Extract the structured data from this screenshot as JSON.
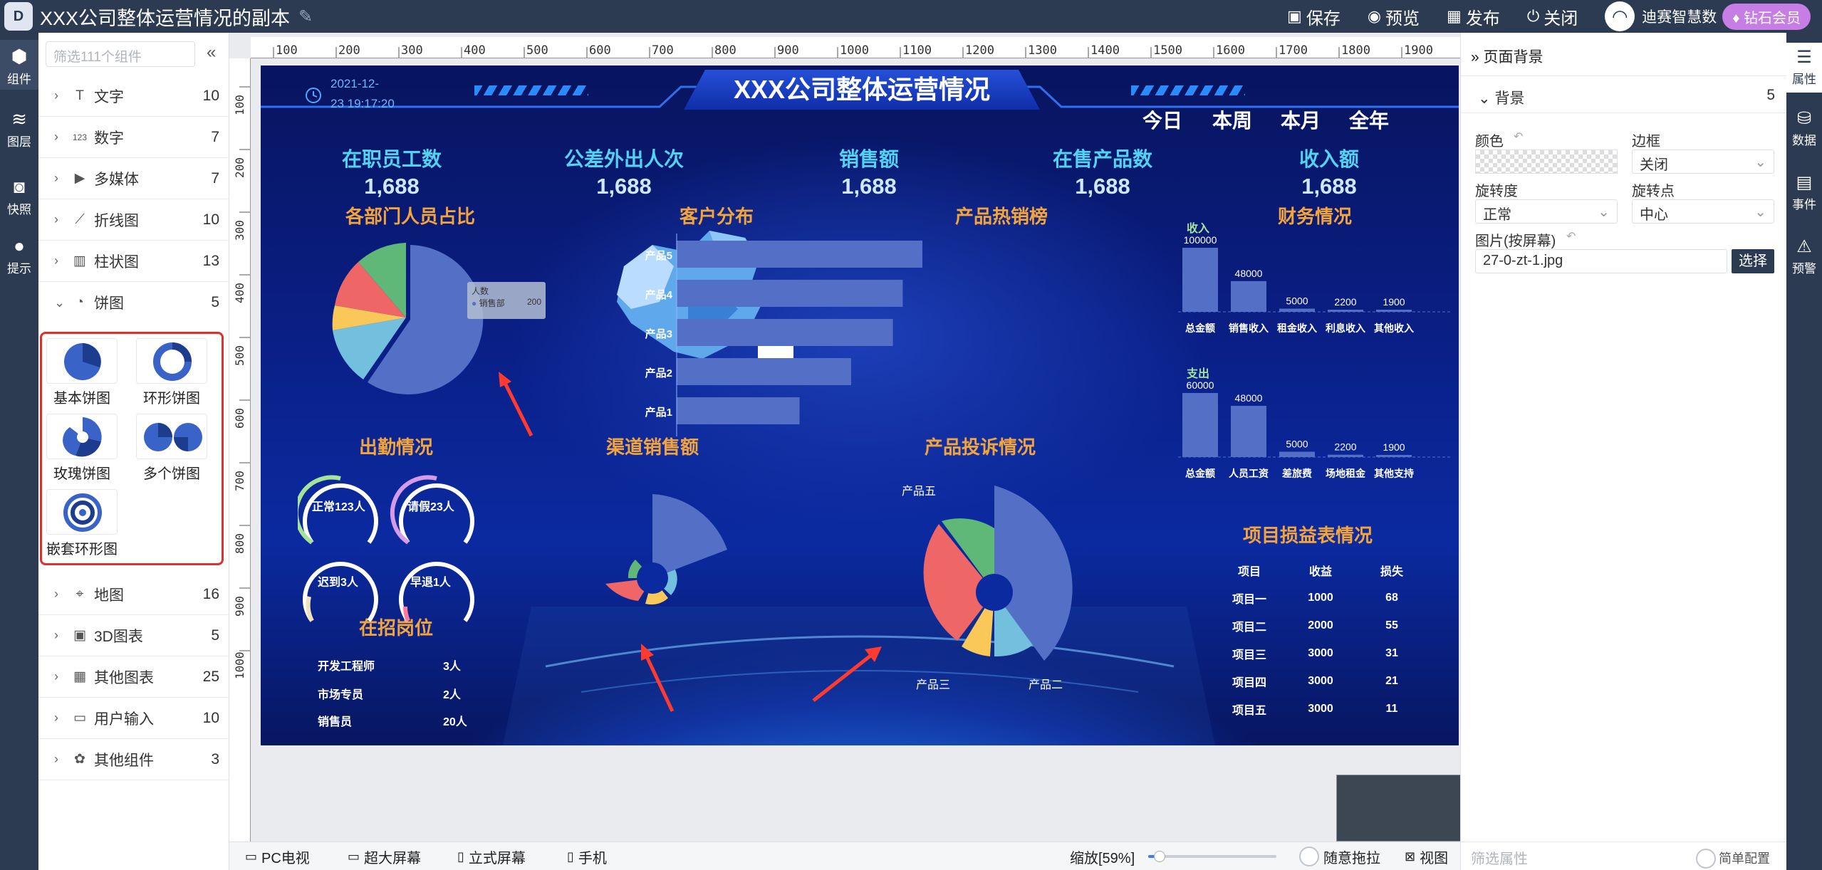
{
  "app": {
    "doc_title": "XXX公司整体运营情况的副本",
    "actions": {
      "save": "保存",
      "preview": "预览",
      "publish": "发布",
      "close": "关闭"
    },
    "user": {
      "name": "迪赛智慧数",
      "badge": "钻石会员"
    }
  },
  "left_rail": [
    {
      "label": "组件",
      "icon": "cube-icon"
    },
    {
      "label": "图层",
      "icon": "layers-icon"
    },
    {
      "label": "快照",
      "icon": "camera-icon"
    },
    {
      "label": "提示",
      "icon": "lightbulb-icon"
    }
  ],
  "component_panel": {
    "search_placeholder": "筛选111个组件",
    "categories": [
      {
        "name": "文字",
        "count": "10",
        "icon": "T"
      },
      {
        "name": "数字",
        "count": "7",
        "icon": "123"
      },
      {
        "name": "多媒体",
        "count": "7",
        "icon": "▶"
      },
      {
        "name": "折线图",
        "count": "10",
        "icon": "⟋"
      },
      {
        "name": "柱状图",
        "count": "13",
        "icon": "▥"
      },
      {
        "name": "饼图",
        "count": "5",
        "icon": "◔"
      }
    ],
    "pie_items": [
      {
        "label": "基本饼图"
      },
      {
        "label": "环形饼图"
      },
      {
        "label": "玫瑰饼图"
      },
      {
        "label": "多个饼图"
      },
      {
        "label": "嵌套环形图"
      }
    ],
    "categories_after": [
      {
        "name": "地图",
        "count": "16",
        "icon": "⌖"
      },
      {
        "name": "3D图表",
        "count": "5",
        "icon": "▣"
      },
      {
        "name": "其他图表",
        "count": "25",
        "icon": "▦"
      },
      {
        "name": "用户输入",
        "count": "10",
        "icon": "▭"
      },
      {
        "name": "其他组件",
        "count": "3",
        "icon": "✿"
      }
    ]
  },
  "ruler": {
    "top_ticks": [
      "100",
      "200",
      "300",
      "400",
      "500",
      "600",
      "700",
      "800",
      "900",
      "1000",
      "1100",
      "1200",
      "1300",
      "1400",
      "1500",
      "1600",
      "1700",
      "1800",
      "1900"
    ],
    "left_ticks": [
      "100",
      "200",
      "300",
      "400",
      "500",
      "600",
      "700",
      "800",
      "900",
      "1000"
    ]
  },
  "dashboard": {
    "title": "XXX公司整体运营情况",
    "datetime_line1": "2021-12-",
    "datetime_line2": "23 19:17:20",
    "periods": [
      "今日",
      "本周",
      "本月",
      "全年"
    ],
    "stats": [
      {
        "label": "在职员工数",
        "value": "1,688"
      },
      {
        "label": "公差外出人次",
        "value": "1,688"
      },
      {
        "label": "销售额",
        "value": "1,688"
      },
      {
        "label": "在售产品数",
        "value": "1,688"
      },
      {
        "label": "收入额",
        "value": "1,688"
      }
    ],
    "sections": {
      "dept": "各部门人员占比",
      "customer": "客户分布",
      "hot": "产品热销榜",
      "finance": "财务情况",
      "attendance": "出勤情况",
      "channel": "渠道销售额",
      "complaint": "产品投诉情况",
      "pnl": "项目损益表情况",
      "jobs": "在招岗位"
    },
    "dept_pie": {
      "tooltip_title": "人数",
      "tooltip_series": "销售部",
      "tooltip_value": "200",
      "colors": [
        "#5470c6",
        "#73c0de",
        "#fac858",
        "#ee6666",
        "#5fb878"
      ]
    },
    "hot_products": {
      "labels": [
        "产品5",
        "产品4",
        "产品3",
        "产品2",
        "产品1"
      ],
      "values": [
        100,
        92,
        88,
        71,
        50
      ]
    },
    "finance_income": {
      "legend": "收入",
      "categories": [
        "总金额",
        "销售收入",
        "租金收入",
        "利息收入",
        "其他收入"
      ],
      "values": [
        "100000",
        "48000",
        "5000",
        "2200",
        "1900"
      ],
      "nums": [
        100000,
        48000,
        5000,
        2200,
        1900
      ]
    },
    "finance_expense": {
      "legend": "支出",
      "categories": [
        "总金额",
        "人员工资",
        "差旅费",
        "场地租金",
        "其他支持"
      ],
      "values": [
        "60000",
        "48000",
        "5000",
        "2200",
        "1900"
      ],
      "nums": [
        60000,
        48000,
        5000,
        2200,
        1900
      ]
    },
    "attendance": [
      {
        "label": "正常123人",
        "color": "#a6e39a"
      },
      {
        "label": "请假23人",
        "color": "#d59be8"
      },
      {
        "label": "迟到3人",
        "color": "#f0e1c2"
      },
      {
        "label": "早退1人",
        "color": "#ff7aa0"
      }
    ],
    "jobs": [
      {
        "name": "开发工程师",
        "count": "3人"
      },
      {
        "name": "市场专员",
        "count": "2人"
      },
      {
        "name": "销售员",
        "count": "20人"
      }
    ],
    "complaint_labels": {
      "a": "产品五",
      "b": "产品三",
      "c": "产品二"
    },
    "pnl": {
      "headers": [
        "项目",
        "收益",
        "损失"
      ],
      "rows": [
        [
          "项目一",
          "1000",
          "68"
        ],
        [
          "项目二",
          "2000",
          "55"
        ],
        [
          "项目三",
          "3000",
          "31"
        ],
        [
          "项目四",
          "3000",
          "21"
        ],
        [
          "项目五",
          "3000",
          "11"
        ]
      ]
    }
  },
  "property_panel": {
    "title": "页面背景",
    "section": "背景",
    "section_count": "5",
    "color_label": "颜色",
    "border_label": "边框",
    "border_value": "关闭",
    "rotation_label": "旋转度",
    "rotation_value": "正常",
    "pivot_label": "旋转点",
    "pivot_value": "中心",
    "image_label": "图片(按屏幕)",
    "image_value": "27-0-zt-1.jpg",
    "choose_button": "选择",
    "filter_placeholder": "筛选属性",
    "simple_config": "简单配置"
  },
  "right_rail": [
    {
      "label": "属性",
      "icon": "properties-icon"
    },
    {
      "label": "数据",
      "icon": "database-icon"
    },
    {
      "label": "事件",
      "icon": "event-icon"
    },
    {
      "label": "预警",
      "icon": "alarm-icon"
    }
  ],
  "bottom_bar": {
    "tabs": [
      "PC电视",
      "超大屏幕",
      "立式屏幕",
      "手机"
    ],
    "zoom_label": "缩放[59%]",
    "zoom_level": 0.59,
    "drag_label": "随意拖拉",
    "view_label": "视图"
  }
}
